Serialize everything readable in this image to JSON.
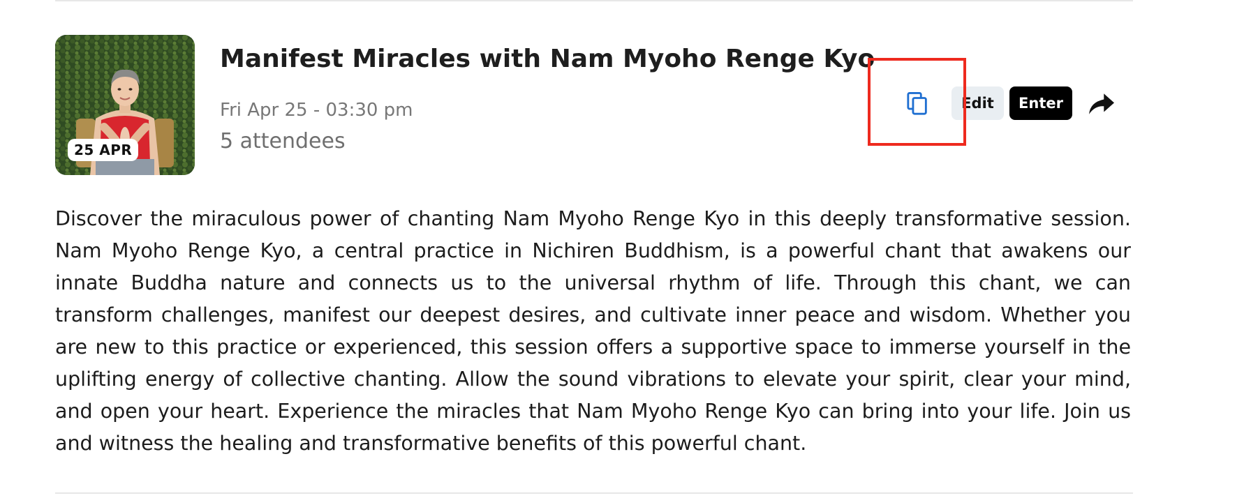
{
  "event": {
    "date_badge": "25 APR",
    "title": "Manifest Miracles with Nam Myoho Renge Kyo",
    "datetime": "Fri Apr 25 - 03:30 pm",
    "attendees": "5 attendees",
    "description": "Discover the miraculous power of chanting Nam Myoho Renge Kyo in this deeply transformative session. Nam Myoho Renge Kyo, a central practice in Nichiren Buddhism, is a powerful chant that awakens our innate Buddha nature and connects us to the universal rhythm of life. Through this chant, we can transform challenges, manifest our deepest desires, and cultivate inner peace and wisdom. Whether you are new to this practice or experienced, this session offers a supportive space to immerse yourself in the uplifting energy of collective chanting. Allow the sound vibrations to elevate your spirit, clear your mind, and open your heart. Experience the miracles that Nam Myoho Renge Kyo can bring into your life. Join us and witness the healing and transformative benefits of this powerful chant."
  },
  "actions": {
    "copy_icon": "copy-icon",
    "edit_label": "Edit",
    "enter_label": "Enter",
    "share_icon": "share-icon"
  },
  "colors": {
    "copy_icon": "#1f6fd1",
    "highlight": "#ee2a1e",
    "enter_bg": "#000000",
    "edit_bg": "#e9eef2",
    "muted_text": "#777777"
  }
}
